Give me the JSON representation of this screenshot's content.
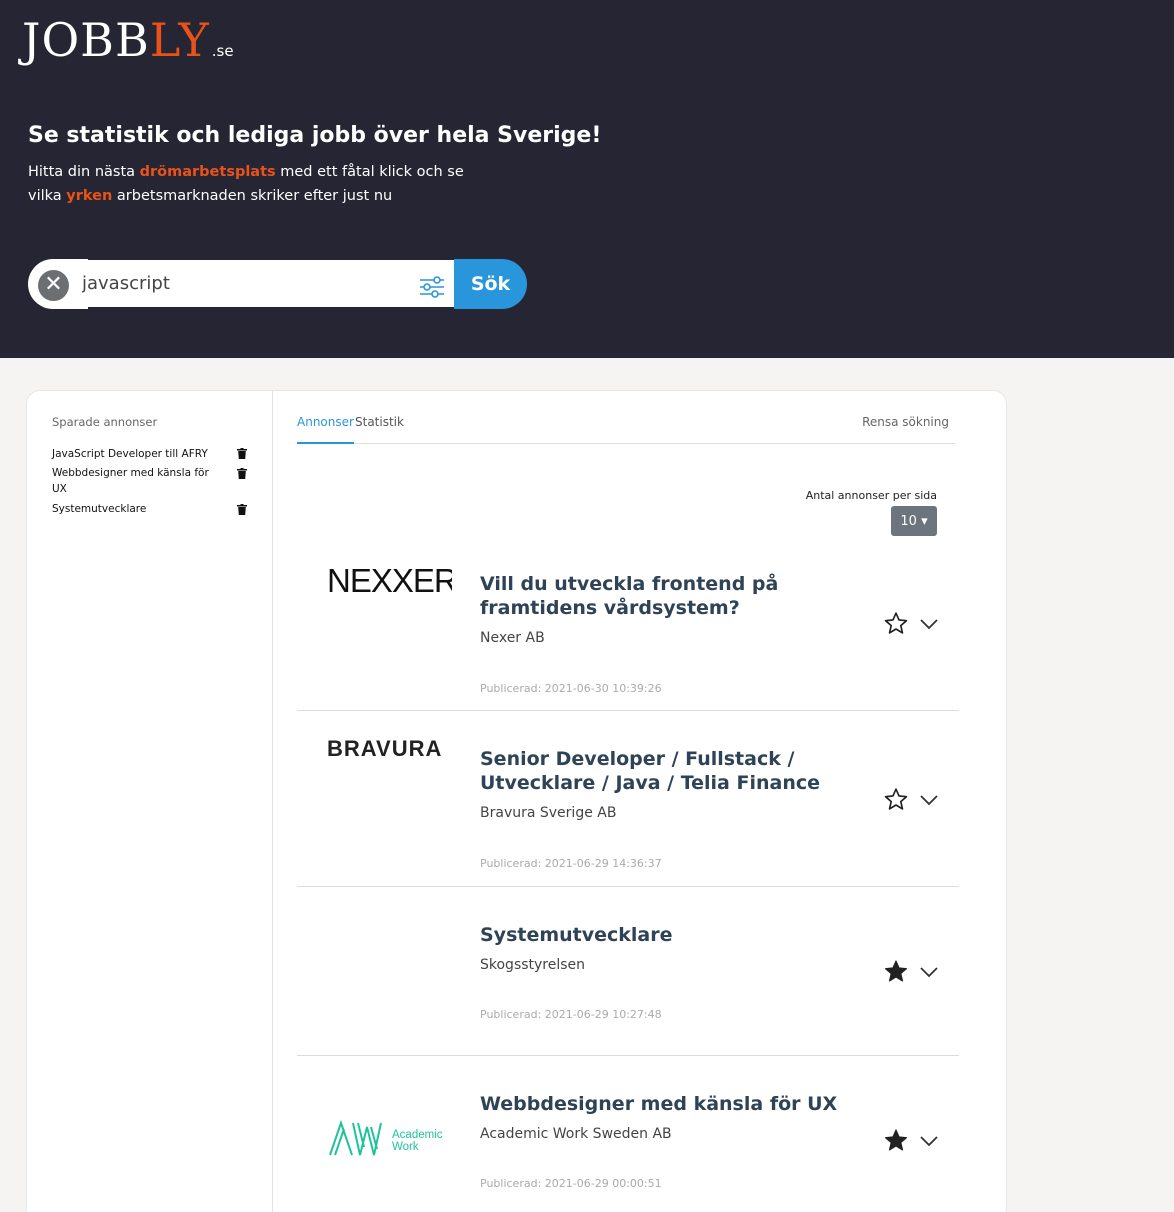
{
  "brand": {
    "logo_main": "JOBB",
    "logo_accent": "LY",
    "logo_tld": ".se",
    "accent_color": "#e9531a"
  },
  "hero": {
    "headline": "Se statistik och lediga jobb över hela Sverige!",
    "sub_part1": "Hitta din nästa ",
    "sub_hl1": "drömarbetsplats",
    "sub_part2": " med ett fåtal klick och se vilka ",
    "sub_hl2": "yrken",
    "sub_part3": " arbetsmarknaden skriker efter just nu"
  },
  "search": {
    "value": "javascript",
    "button_label": "Sök",
    "clear_icon": "close-icon",
    "filter_icon": "sliders-icon"
  },
  "sidebar": {
    "title": "Sparade annonser",
    "items": [
      {
        "label": "JavaScript Developer till AFRY"
      },
      {
        "label": "Webbdesigner med känsla för UX"
      },
      {
        "label": "Systemutvecklare"
      }
    ]
  },
  "tabs": [
    {
      "label": "Annonser",
      "active": true
    },
    {
      "label": "Statistik",
      "active": false
    }
  ],
  "clear_search_label": "Rensa sökning",
  "per_page": {
    "label": "Antal annonser per sida",
    "value": "10"
  },
  "jobs": [
    {
      "title": "Vill du utveckla frontend på framtidens vårdsystem?",
      "company": "Nexer AB",
      "published": "Publicerad: 2021-06-30 10:39:26",
      "logo_text": "NEXXER",
      "saved": false
    },
    {
      "title": "Senior Developer / Fullstack / Utvecklare / Java / Telia Finance",
      "company": "Bravura Sverige AB",
      "published": "Publicerad: 2021-06-29 14:36:37",
      "logo_text": "BRAVURA",
      "saved": false
    },
    {
      "title": "Systemutvecklare",
      "company": "Skogsstyrelsen",
      "published": "Publicerad: 2021-06-29 10:27:48",
      "logo_text": "",
      "saved": true
    },
    {
      "title": "Webbdesigner med känsla för UX",
      "company": "Academic Work Sweden AB",
      "published": "Publicerad: 2021-06-29 00:00:51",
      "logo_text": "AW",
      "logo_sub1": "Academic",
      "logo_sub2": "Work",
      "saved": true
    }
  ],
  "colors": {
    "hero_bg": "#262533",
    "primary_blue": "#2996dc",
    "page_bg": "#f5f4f2",
    "academic_work_green": "#1fc39a"
  }
}
